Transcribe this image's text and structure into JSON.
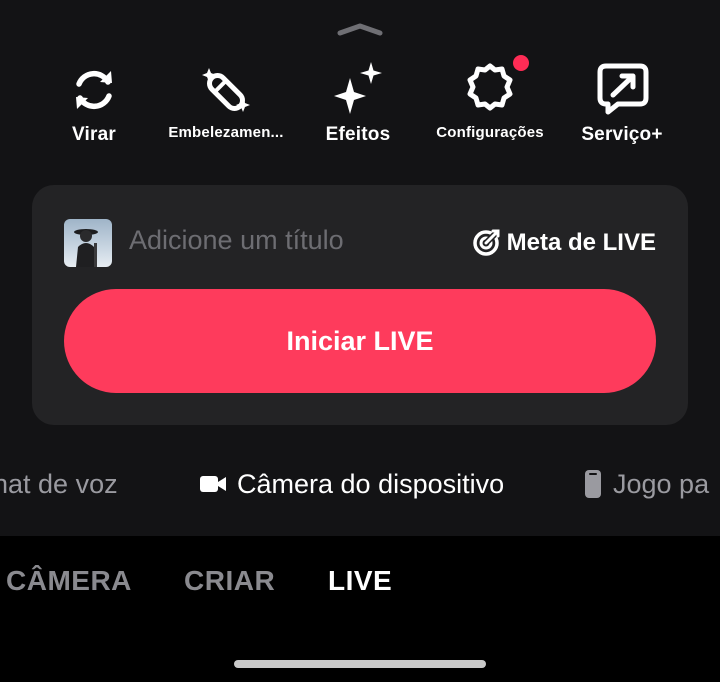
{
  "toolbar": {
    "items": [
      {
        "label": "Virar",
        "icon": "flip-camera-icon"
      },
      {
        "label": "Embelezamen...",
        "icon": "beauty-wand-icon"
      },
      {
        "label": "Efeitos",
        "icon": "sparkles-icon"
      },
      {
        "label": "Configurações",
        "icon": "settings-gear-icon",
        "notification_dot": true
      },
      {
        "label": "Serviço+",
        "icon": "share-chat-icon"
      }
    ]
  },
  "live_panel": {
    "title_placeholder": "Adicione um título",
    "goal_label": "Meta de LIVE",
    "start_button": "Iniciar LIVE"
  },
  "live_modes": [
    {
      "label": "hat de voz",
      "icon": null
    },
    {
      "label": "Câmera do dispositivo",
      "icon": "video-camera-icon",
      "active": true
    },
    {
      "label": "Jogo pa",
      "icon": "phone-icon"
    }
  ],
  "bottom_tabs": [
    {
      "label": "CÂMERA",
      "active": false
    },
    {
      "label": "CRIAR",
      "active": false
    },
    {
      "label": "LIVE",
      "active": true
    }
  ],
  "colors": {
    "accent": "#fe3b5c",
    "notification_dot": "#fe2c55",
    "panel_bg": "#232325",
    "background": "#131315"
  }
}
